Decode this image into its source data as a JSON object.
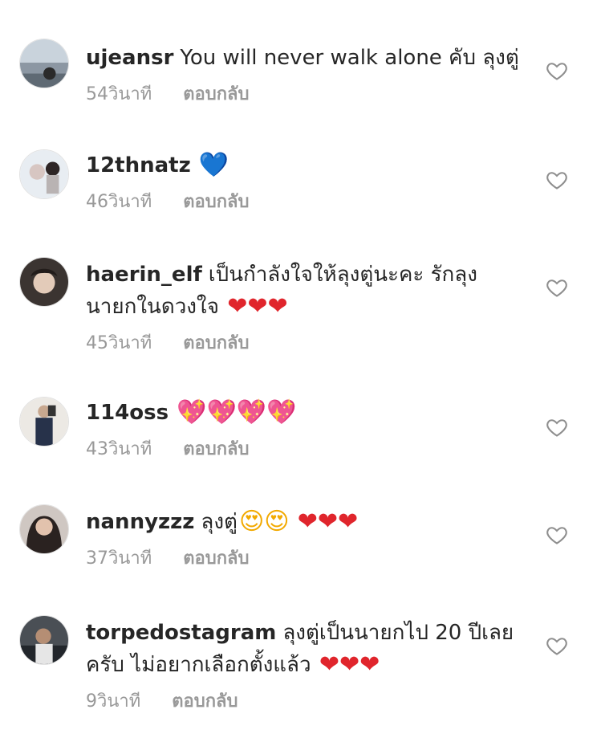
{
  "comments": [
    {
      "username": "ujeansr",
      "text": "You will never walk alone คับ ลุงตู่",
      "time": "54วินาที",
      "reply": "ตอบกลับ"
    },
    {
      "username": "12thnatz",
      "text": "",
      "emojis": "💙",
      "time": "46วินาที",
      "reply": "ตอบกลับ"
    },
    {
      "username": "haerin_elf",
      "text": "เป็นกำลังใจให้ลุงตู่นะคะ รักลุงนายกในดวงใจ",
      "emojis": "❤❤❤",
      "time": "45วินาที",
      "reply": "ตอบกลับ"
    },
    {
      "username": "114oss",
      "text": "",
      "emojis": "💖💖💖💖",
      "time": "43วินาที",
      "reply": "ตอบกลับ"
    },
    {
      "username": "nannyzzz",
      "text": "ลุงตู่",
      "emojis_face": "😍😍",
      "emojis": "❤❤❤",
      "time": "37วินาที",
      "reply": "ตอบกลับ"
    },
    {
      "username": "torpedostagram",
      "text": "ลุงตู่เป็นนายกไป 20 ปีเลยครับ ไม่อยากเลือกตั้งแล้ว",
      "emojis": "❤❤❤",
      "time": "9วินาที",
      "reply": "ตอบกลับ"
    }
  ],
  "icons": {
    "like": "heart-outline-icon"
  },
  "colors": {
    "text": "#262626",
    "muted": "#999999"
  }
}
